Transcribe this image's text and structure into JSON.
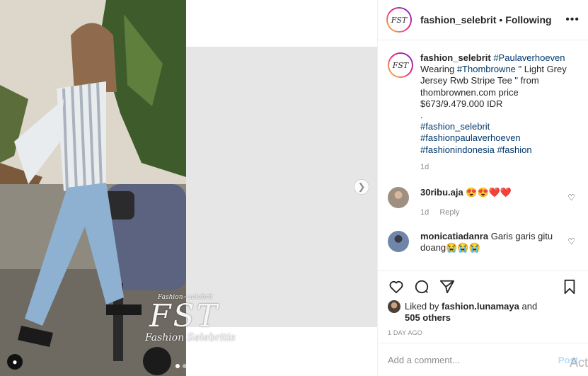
{
  "media": {
    "next_icon": "chevron-right-icon",
    "watermark": {
      "top": "Fashion~selebrit",
      "big": "FST",
      "bottom": "Fashion Selebritis"
    },
    "carousel_dots": 2
  },
  "header": {
    "avatar_text": "FST",
    "username": "fashion_selebrit",
    "separator": "•",
    "following": "Following",
    "more_icon": "ellipsis-icon",
    "more_glyph": "•••"
  },
  "caption": {
    "avatar_text": "FST",
    "username": "fashion_selebrit",
    "tag1": "#Paulaverhoeven",
    "line1_pre": "Wearing",
    "tag2": "#Thombrowne",
    "line1_post": "\" Light Grey Jersey Rwb Stripe Tee \" from thombrownen.com price $673/9.479.000 IDR",
    "dot": ".",
    "tags": [
      "#fashion_selebrit",
      "#fashionpaulaverhoeven",
      "#fashionindonesia",
      "#fashion"
    ],
    "time": "1d"
  },
  "comments": [
    {
      "user": "30ribu.aja",
      "text": "😍😍❤️❤️",
      "time": "1d",
      "reply": "Reply"
    },
    {
      "user": "monicatiadanra",
      "text": "Garis garis gitu doang😭😭😭",
      "time": "",
      "reply": ""
    }
  ],
  "actions": {
    "icons": [
      "heart-icon",
      "comment-icon",
      "share-icon",
      "bookmark-icon"
    ],
    "liked_by_prefix": "Liked by",
    "liked_by_user": "fashion.lunamaya",
    "liked_by_and": "and",
    "others": "505 others",
    "time_ago": "1 DAY AGO"
  },
  "add_comment": {
    "placeholder": "Add a comment...",
    "post": "Post"
  },
  "overlay": {
    "activate": "Act"
  }
}
